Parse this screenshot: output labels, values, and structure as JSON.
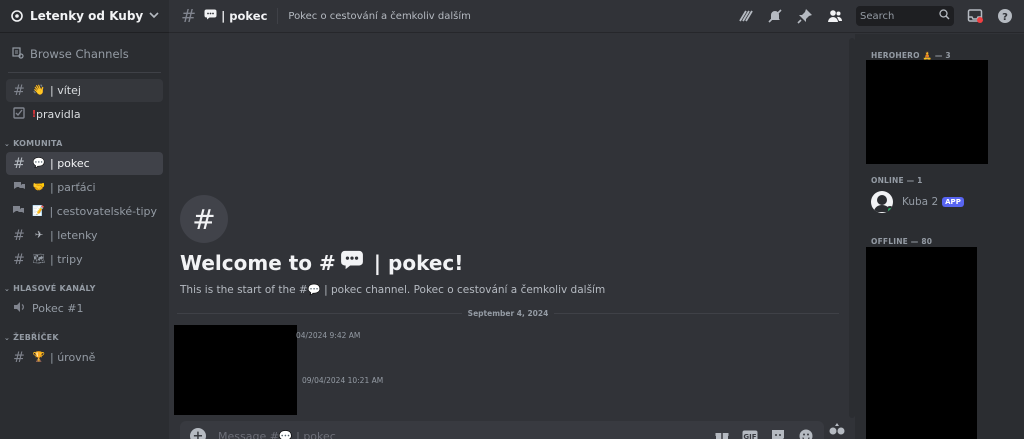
{
  "server": {
    "name": "Letenky od Kuby"
  },
  "sidebar": {
    "browse_label": "Browse Channels",
    "top_channels": [
      {
        "label": "| vítej",
        "emoji": "👋"
      },
      {
        "label": "pravidla",
        "emoji": "!"
      }
    ],
    "categories": [
      {
        "label": "KOMUNITA",
        "channels": [
          {
            "label": "| pokec",
            "emoji": "💬",
            "active": true
          },
          {
            "label": "| parťáci",
            "emoji": "🤝"
          },
          {
            "label": "| cestovatelské-tipy",
            "emoji": "📝"
          },
          {
            "label": "| letenky",
            "emoji": "✈"
          },
          {
            "label": "| tripy",
            "emoji": "🗺"
          }
        ]
      },
      {
        "label": "HLASOVÉ KANÁLY",
        "channels": [
          {
            "label": "Pokec #1"
          }
        ]
      },
      {
        "label": "ŽEBŘÍČEK",
        "channels": [
          {
            "label": "| úrovně",
            "emoji": "🏆"
          }
        ]
      }
    ]
  },
  "header": {
    "channel_name": "| pokec",
    "topic": "Pokec o cestování a čemkoliv dalším",
    "search_placeholder": "Search"
  },
  "main": {
    "welcome_prefix": "Welcome to #",
    "welcome_suffix": "| pokec!",
    "welcome_sub": "This is the start of the #💬 | pokec channel. Pokec o cestování a čemkoliv dalším",
    "date_divider": "September 4, 2024",
    "timestamps": [
      "04/2024 9:42 AM",
      "09/04/2024 10:21 AM"
    ],
    "composer_placeholder": "Message #💬 | pokec"
  },
  "members": {
    "group_herohero": "HEROHERO 🧘 — 3",
    "group_online": "ONLINE — 1",
    "group_offline": "OFFLINE — 80",
    "online_member": {
      "name": "Kuba 2",
      "badge": "APP"
    }
  },
  "colors": {
    "accent": "#5865f2",
    "online": "#23a55a",
    "sidebar": "#2b2d31",
    "main": "#313338"
  }
}
